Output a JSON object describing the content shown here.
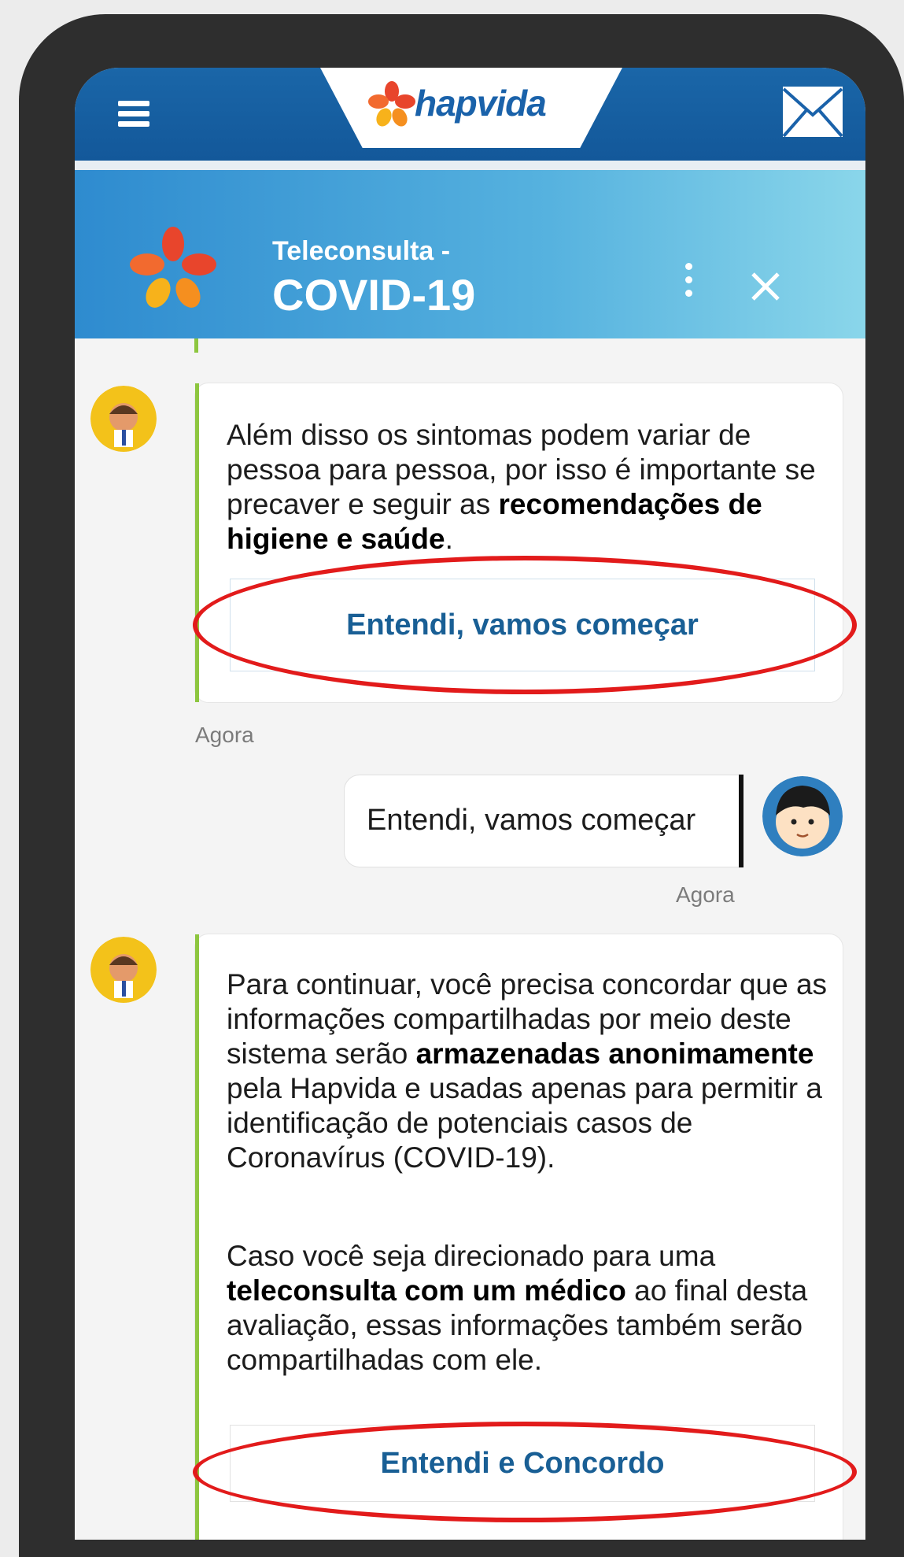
{
  "app": {
    "brand": "hapvida",
    "menu_icon": "menu-icon",
    "mail_icon": "mail-icon"
  },
  "chat_header": {
    "subtitle": "Teleconsulta -",
    "title": "COVID-19",
    "more_icon": "kebab-icon",
    "close_icon": "close-icon"
  },
  "messages": [
    {
      "from": "bot",
      "text_parts": [
        "Além disso os sintomas podem variar de pessoa para pessoa, por isso é importante se precaver e seguir as ",
        "recomendações de higiene e saúde",
        "."
      ],
      "button": "Entendi, vamos começar",
      "time": "Agora"
    },
    {
      "from": "user",
      "text": "Entendi, vamos começar",
      "time": "Agora"
    },
    {
      "from": "bot",
      "p1_parts": [
        "Para continuar, você precisa concordar que as informações compartilhadas por meio deste sistema serão ",
        "armazenadas anonimamente",
        " pela Hapvida e usadas apenas para permitir a identificação de potenciais casos de Coronavírus (COVID-19)."
      ],
      "p2_parts": [
        "Caso você seja direcionado para uma ",
        "teleconsulta com um médico",
        " ao final desta avaliação, essas informações também serão compartilhadas com ele."
      ],
      "button": "Entendi e Concordo"
    }
  ],
  "colors": {
    "appbar": "#1a62aa",
    "accent_green": "#8dc63f",
    "annotation_red": "#e21b1b",
    "button_text": "#195f95"
  }
}
